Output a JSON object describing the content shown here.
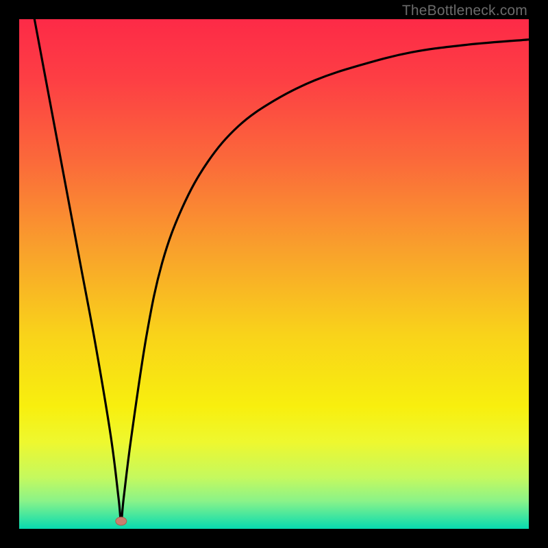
{
  "watermark": "TheBottleneck.com",
  "colors": {
    "frame": "#000000",
    "curve": "#000000",
    "marker_fill": "#c97f6f",
    "marker_stroke": "#a8614f",
    "gradient_stops": [
      {
        "offset": 0.0,
        "color": "#fd2a47"
      },
      {
        "offset": 0.12,
        "color": "#fd3f44"
      },
      {
        "offset": 0.28,
        "color": "#fb6a3a"
      },
      {
        "offset": 0.45,
        "color": "#f9a02c"
      },
      {
        "offset": 0.62,
        "color": "#f9d31a"
      },
      {
        "offset": 0.76,
        "color": "#f8ef0e"
      },
      {
        "offset": 0.83,
        "color": "#eef82f"
      },
      {
        "offset": 0.9,
        "color": "#c4f95f"
      },
      {
        "offset": 0.945,
        "color": "#8bf388"
      },
      {
        "offset": 0.975,
        "color": "#42e69f"
      },
      {
        "offset": 1.0,
        "color": "#07dab0"
      }
    ]
  },
  "chart_data": {
    "type": "line",
    "title": "",
    "xlabel": "",
    "ylabel": "",
    "xlim": [
      0,
      100
    ],
    "ylim": [
      0,
      100
    ],
    "marker": {
      "x": 20,
      "y": 1.5
    },
    "series": [
      {
        "name": "bottleneck-curve",
        "x": [
          3,
          6,
          9,
          12,
          15,
          18,
          19.5,
          20,
          20.5,
          22,
          25,
          28,
          32,
          37,
          43,
          50,
          58,
          67,
          77,
          88,
          100
        ],
        "values": [
          100,
          84,
          68,
          52,
          36,
          18,
          6,
          1.5,
          6,
          18,
          38,
          52,
          63,
          72,
          79,
          84,
          88,
          91,
          93.5,
          95,
          96
        ]
      }
    ]
  }
}
